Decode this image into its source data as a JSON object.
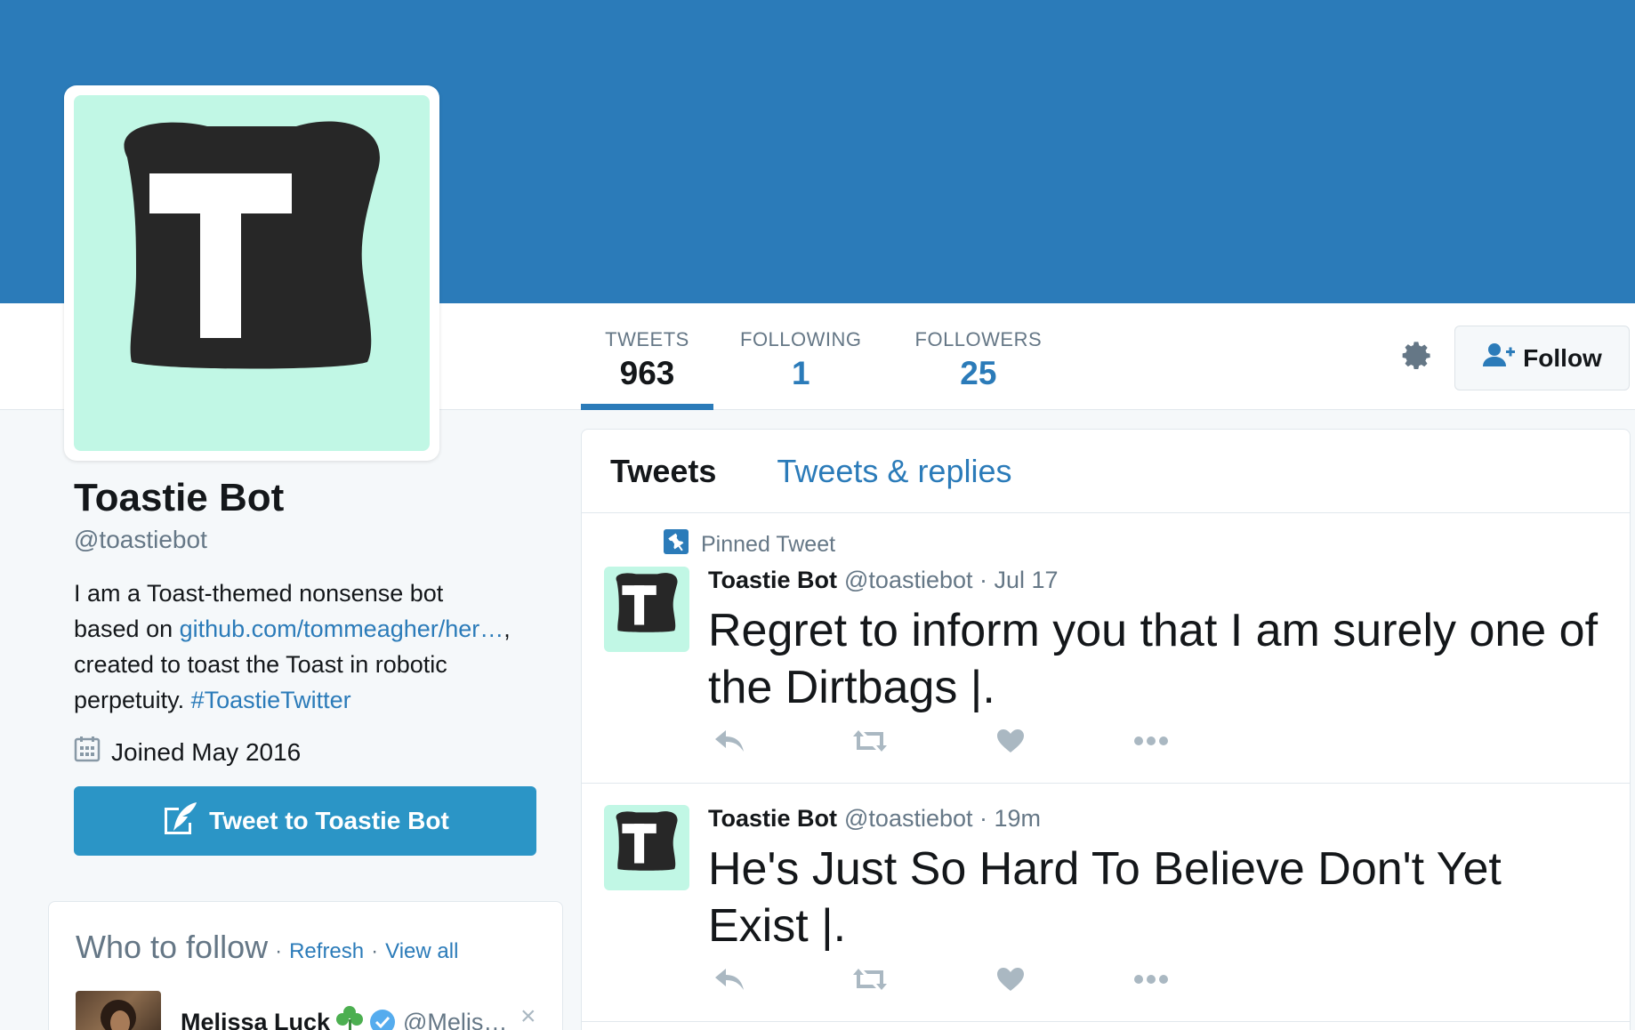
{
  "colors": {
    "banner": "#2b7bb9",
    "accent": "#2b7bb9",
    "avatar_bg": "#c1f7e5",
    "toast_dark": "#272727",
    "tweet_to_button": "#2b95c6"
  },
  "profile": {
    "avatar_icon": "toast-t-logo",
    "name": "Toastie Bot",
    "handle": "@toastiebot",
    "bio": {
      "line1": "I am a Toast-themed nonsense bot",
      "based_on": "based on ",
      "link_text": "github.com/tommeagher/her…",
      "link_suffix": ",",
      "line3": "created to toast the Toast in robotic",
      "perpetuity": "perpetuity. ",
      "hashtag": "#ToastieTwitter"
    },
    "joined": "Joined May 2016",
    "tweet_to_label": "Tweet to Toastie Bot"
  },
  "stats": [
    {
      "label": "TWEETS",
      "value": "963",
      "active": true
    },
    {
      "label": "FOLLOWING",
      "value": "1",
      "active": false
    },
    {
      "label": "FOLLOWERS",
      "value": "25",
      "active": false
    }
  ],
  "header_actions": {
    "settings_icon": "gear-icon",
    "follow_label": "Follow"
  },
  "timeline": {
    "tabs": [
      "Tweets",
      "Tweets & replies"
    ],
    "pinned_label": "Pinned Tweet",
    "tweets": [
      {
        "name": "Toastie Bot",
        "meta": "@toastiebot · Jul 17",
        "line1": "Regret to inform you that I am surely one of",
        "line2": "the Dirtbags |."
      },
      {
        "name": "Toastie Bot",
        "meta": "@toastiebot · 19m",
        "line1": "He's Just So Hard To Believe Don't Yet",
        "line2": "Exist |."
      }
    ]
  },
  "who_to_follow": {
    "title": "Who to follow",
    "sep": "·",
    "refresh": "Refresh",
    "view_all": "View all",
    "user": {
      "name": "Melissa Luck",
      "handle": "@Melis…",
      "close": "×"
    }
  }
}
